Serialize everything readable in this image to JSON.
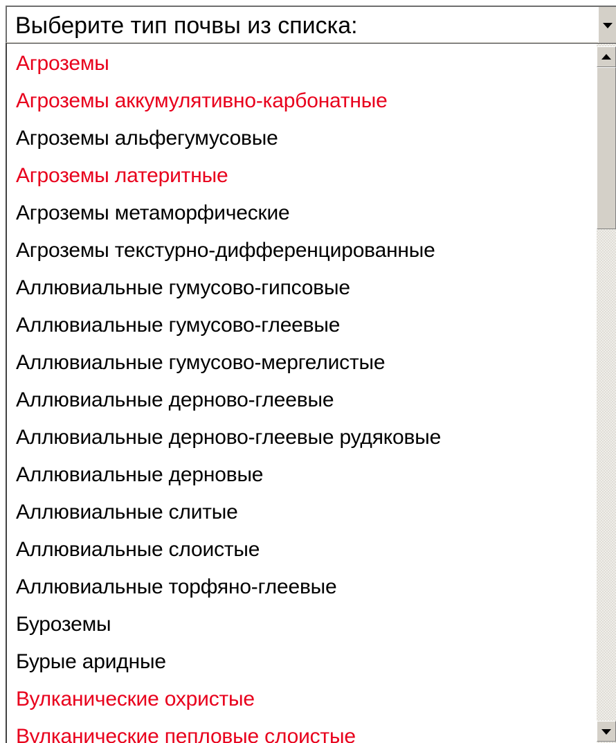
{
  "combo": {
    "value": "Выберите тип почвы из списка:",
    "dropdown_icon": "chevron-down-icon"
  },
  "colors": {
    "highlight_text": "#e8001c",
    "normal_text": "#000000"
  },
  "items": [
    {
      "label": "Агроземы",
      "highlight": true
    },
    {
      "label": "Агроземы аккумулятивно-карбонатные",
      "highlight": true
    },
    {
      "label": "Агроземы альфегумусовые",
      "highlight": false
    },
    {
      "label": "Агроземы латеритные",
      "highlight": true
    },
    {
      "label": "Агроземы метаморфические",
      "highlight": false
    },
    {
      "label": "Агроземы текстурно-дифференцированные",
      "highlight": false
    },
    {
      "label": "Аллювиальные гумусово-гипсовые",
      "highlight": false
    },
    {
      "label": "Аллювиальные гумусово-глеевые",
      "highlight": false
    },
    {
      "label": "Аллювиальные гумусово-мергелистые",
      "highlight": false
    },
    {
      "label": "Аллювиальные дерново-глеевые",
      "highlight": false
    },
    {
      "label": "Аллювиальные дерново-глеевые рудяковые",
      "highlight": false
    },
    {
      "label": "Аллювиальные дерновые",
      "highlight": false
    },
    {
      "label": "Аллювиальные слитые",
      "highlight": false
    },
    {
      "label": "Аллювиальные слоистые",
      "highlight": false
    },
    {
      "label": "Аллювиальные торфяно-глеевые",
      "highlight": false
    },
    {
      "label": "Буроземы",
      "highlight": false
    },
    {
      "label": "Бурые аридные",
      "highlight": false
    },
    {
      "label": "Вулканические охристые",
      "highlight": true
    },
    {
      "label": "Вулканические пепловые слоистые",
      "highlight": true
    }
  ]
}
